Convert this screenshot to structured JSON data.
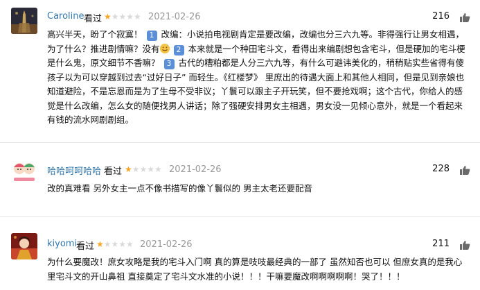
{
  "reviews": [
    {
      "user": "Caroline",
      "rated_label": "看过",
      "stars": 1,
      "date": "2021-02-26",
      "votes": "216",
      "avatar": "avatar-photo-city-tower",
      "text": {
        "p1": "高兴半天，盼了个寂寞！",
        "n1": "1",
        "p2": "改编：小说拍电视剧肯定是要改编，改编也分三六九等。非得强行让男女相遇，为了什么？推进剧情嘛？没有",
        "p3": "",
        "n2": "2",
        "p4": "本来就是一个种田宅斗文，看得出来编剧想包含宅斗，但是硬加的宅斗梗是什么鬼，原文细节不香嘛？",
        "n3": "3",
        "p5": "古代的糟粕都是人分三六九等，有什么可避讳美化的，稍稍贴实些省得有傻孩子以为可以穿越到过去“过好日子” 而轻生。《红楼梦》 里庶出的待遇大面上和其他人相同，但是见到亲娘也知道避险，不是忘恩而是为了生母不受非议；丫鬟可以跟主子开玩笑，但不要抢戏啊；这个古代，你给人的感觉是什么改编，怎么女的随便找男人讲话；除了强硬安排男女主相遇，男女没一见倾心意外，就是一个看起来有钱的流水网剧剧组。"
      }
    },
    {
      "user": "哈哈呵呵哈哈",
      "rated_label": "看过",
      "stars": 1,
      "date": "2021-02-26",
      "votes": "228",
      "avatar": "avatar-cartoon-couple",
      "text": "改的真难看 另外女主一点不像书描写的像丫鬟似的 男主太老还要配音"
    },
    {
      "user": "kiyomi",
      "rated_label": "看过",
      "stars": 1,
      "date": "2021-02-26",
      "votes": "211",
      "avatar": "avatar-anime-red",
      "text": "为什么要魔改！庶女攻略是我的宅斗入门啊 真的算是吱吱最经典的一部了 虽然知否也可以 但庶女真的是我心里宅斗文的开山鼻祖 直接奠定了宅斗文水准的小说！！！干嘛要魔改啊啊啊啊啊！哭了！！！"
    }
  ],
  "colors": {
    "link": "#3377aa",
    "star": "#f5a623",
    "date": "#999999",
    "badge": "#5b8fd8"
  },
  "icons": {
    "vote": "thumbs-up-icon",
    "emoji": "sweat-smile-emoji"
  }
}
